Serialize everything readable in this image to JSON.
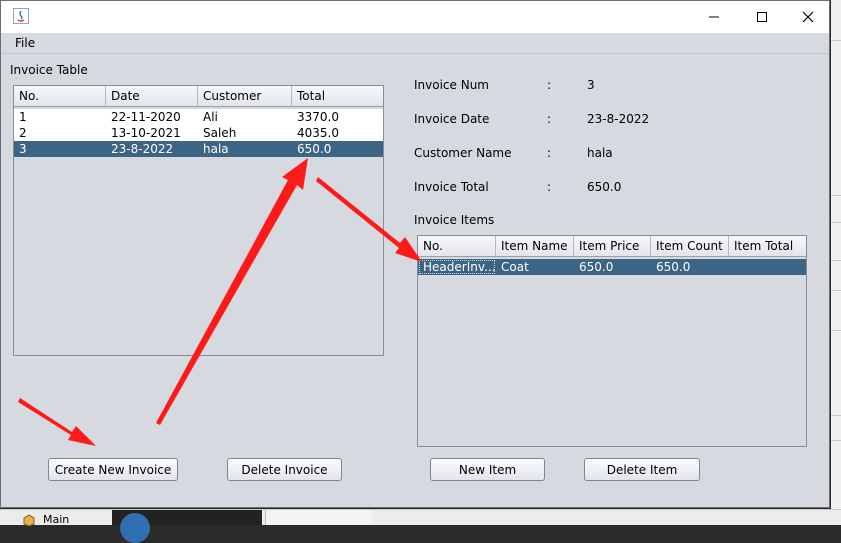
{
  "menu": {
    "file": "File"
  },
  "invoice_table": {
    "title": "Invoice Table",
    "columns": [
      "No.",
      "Date",
      "Customer",
      "Total"
    ],
    "rows": [
      {
        "no": "1",
        "date": "22-11-2020",
        "customer": "Ali",
        "total": "3370.0"
      },
      {
        "no": "2",
        "date": "13-10-2021",
        "customer": "Saleh",
        "total": "4035.0"
      },
      {
        "no": "3",
        "date": "23-8-2022",
        "customer": "hala",
        "total": "650.0"
      }
    ],
    "selected_row_index": 2
  },
  "details": {
    "separator": ":",
    "invoice_num_label": "Invoice Num",
    "invoice_num_value": "3",
    "invoice_date_label": "Invoice Date",
    "invoice_date_value": "23-8-2022",
    "customer_name_label": "Customer Name",
    "customer_name_value": "hala",
    "invoice_total_label": "Invoice Total",
    "invoice_total_value": "650.0"
  },
  "items_table": {
    "title": "Invoice Items",
    "columns": [
      "No.",
      "Item Name",
      "Item Price",
      "Item Count",
      "Item Total"
    ],
    "rows": [
      {
        "no": "HeaderInv...",
        "name": "Coat",
        "price": "650.0",
        "count": "650.0",
        "total": ""
      }
    ]
  },
  "buttons": {
    "create_invoice": "Create New Invoice",
    "delete_invoice": "Delete Invoice",
    "new_item": "New Item",
    "delete_item": "Delete Item"
  },
  "background": {
    "taskbar_label": "Main"
  },
  "colors": {
    "selection": "#3b6485",
    "window_bg": "#d6d9df",
    "arrow": "#ff1a1a"
  }
}
